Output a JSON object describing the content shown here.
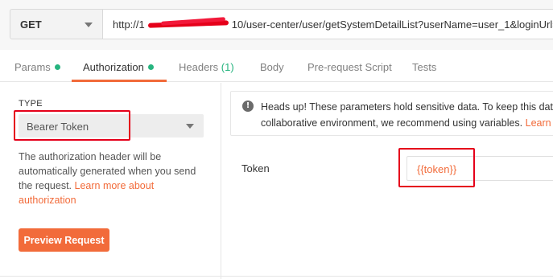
{
  "request": {
    "method": "GET",
    "url_prefix": "http://1",
    "url_suffix": "10/user-center/user/getSystemDetailList?userName=user_1&loginUrl=http"
  },
  "tabs": [
    {
      "label": "Params",
      "status_dot": true
    },
    {
      "label": "Authorization",
      "status_dot": true,
      "active": true
    },
    {
      "label": "Headers",
      "count": "(1)"
    },
    {
      "label": "Body"
    },
    {
      "label": "Pre-request Script"
    },
    {
      "label": "Tests"
    }
  ],
  "auth": {
    "type_label": "TYPE",
    "type_value": "Bearer Token",
    "description": "The authorization header will be automatically generated when you send the request.",
    "learn_more": "Learn more about authorization",
    "preview_button": "Preview Request"
  },
  "notice": {
    "line1": "Heads up! These parameters hold sensitive data. To keep this dat",
    "line2": "collaborative environment, we recommend using variables.",
    "link": "Learn"
  },
  "token": {
    "label": "Token",
    "value": "{{token}}"
  },
  "colors": {
    "accent": "#f26b3a",
    "status_green": "#26b47f",
    "highlight_red": "#e5001a"
  }
}
